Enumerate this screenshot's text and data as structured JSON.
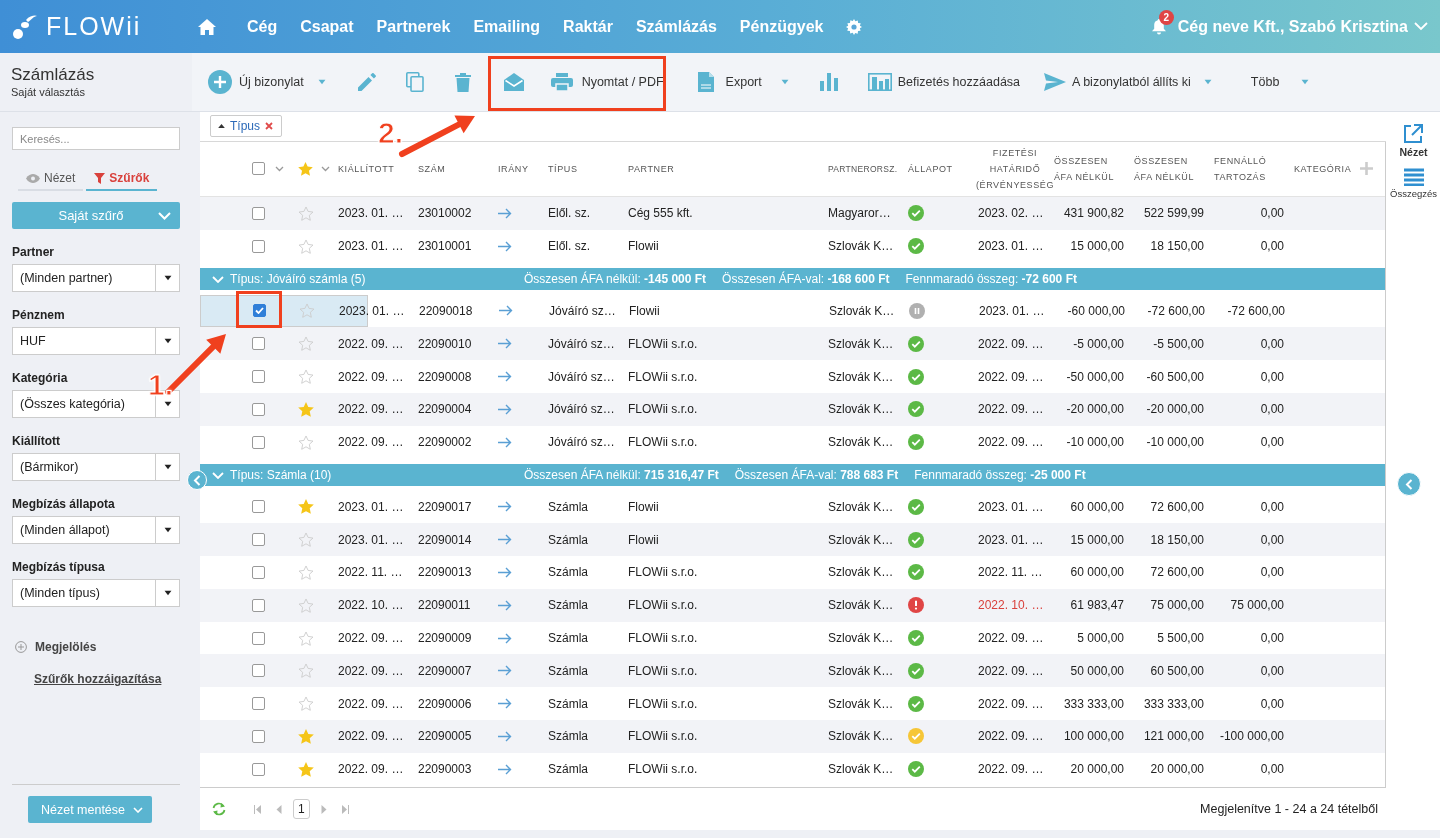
{
  "header": {
    "logo": "FLOWii",
    "nav": [
      {
        "label": "Cég"
      },
      {
        "label": "Csapat"
      },
      {
        "label": "Partnerek"
      },
      {
        "label": "Emailing"
      },
      {
        "label": "Raktár"
      },
      {
        "label": "Számlázás"
      },
      {
        "label": "Pénzügyek"
      }
    ],
    "notifications": "2",
    "user": "Cég neve Kft., Szabó Krisztina"
  },
  "page": {
    "title": "Számlázás",
    "subtitle": "Saját választás"
  },
  "toolbar": [
    {
      "kind": "add",
      "label": "Új bizonylat",
      "dropdown": true
    },
    {
      "kind": "edit"
    },
    {
      "kind": "copy"
    },
    {
      "kind": "delete"
    },
    {
      "kind": "email"
    },
    {
      "kind": "print",
      "label": "Nyomtat / PDF"
    },
    {
      "kind": "export",
      "label": "Export",
      "dropdown": true
    },
    {
      "kind": "stats"
    },
    {
      "kind": "payment",
      "label": "Befizetés hozzáadása"
    },
    {
      "kind": "send",
      "label": "A bizonylatból állíts ki",
      "dropdown": true
    },
    {
      "kind": "more",
      "label": "Több",
      "dropdown": true
    }
  ],
  "sidebar": {
    "search": {
      "placeholder": "Keresés..."
    },
    "tabs": [
      {
        "label": "Nézet",
        "selected": false
      },
      {
        "label": "Szűrők",
        "selected": true
      }
    ],
    "filter_button": "Saját szűrő",
    "filters": [
      {
        "label": "Partner",
        "value": "(Minden partner)"
      },
      {
        "label": "Pénznem",
        "value": "HUF"
      },
      {
        "label": "Kategória",
        "value": "(Összes kategória)"
      },
      {
        "label": "Kiállított",
        "value": "(Bármikor)"
      },
      {
        "label": "Megbízás állapota",
        "value": "(Minden állapot)"
      },
      {
        "label": "Megbízás típusa",
        "value": "(Minden típus)"
      }
    ],
    "mark_link": "Megjelölés",
    "adjust_link": "Szűrők hozzáigazítása",
    "save_button": "Nézet mentése"
  },
  "filter_chips": [
    {
      "label": "Típus"
    }
  ],
  "right_rail": [
    {
      "kind": "view",
      "label": "Nézet"
    },
    {
      "kind": "summary",
      "label": "Összegzés"
    }
  ],
  "table": {
    "all_checked": false,
    "columns": [
      "KIÁLLÍTOTT",
      "SZÁM",
      "IRÁNY",
      "TÍPUS",
      "PARTNER",
      "PARTNERORSZ.",
      "ÁLLAPOT",
      "FIZETÉSI HATÁRIDŐ (ÉRVÉNYESSÉG",
      "ÖSSZESEN ÁFA NÉLKÜL",
      "ÖSSZESEN ÁFA NÉLKÜL",
      "FENNÁLLÓ TARTOZÁS",
      "KATEGÓRIA"
    ],
    "rows": [
      {
        "kind": "row",
        "checked": false,
        "starred": false,
        "issued": "2023. 01. …",
        "number": "23010002",
        "type": "Elől. sz.",
        "partner": "Cég 555 kft.",
        "country": "Magyaror…",
        "status": {
          "kind": "ok"
        },
        "due": "2023. 02. …",
        "overdue": false,
        "net": "431 900,82",
        "gross": "522 599,99",
        "outstanding": "0,00"
      },
      {
        "kind": "row",
        "checked": false,
        "starred": false,
        "issued": "2023. 01. …",
        "number": "23010001",
        "type": "Elől. sz.",
        "partner": "Flowii",
        "country": "Szlovák K…",
        "status": {
          "kind": "ok"
        },
        "due": "2023. 01. …",
        "overdue": false,
        "net": "15 000,00",
        "gross": "18 150,00",
        "outstanding": "0,00"
      },
      {
        "kind": "group",
        "label": "Típus: Jóváíró számla (5)",
        "totals": [
          "Összesen ÁFA nélkül: **-145 000 Ft**",
          "Összesen ÁFA-val: **-168 600 Ft**",
          "Fennmaradó összeg: **-72 600 Ft**"
        ]
      },
      {
        "kind": "row",
        "checked": true,
        "starred": false,
        "issued": "2023. 01. …",
        "number": "22090018",
        "type": "Jóváíró sz…",
        "partner": "Flowii",
        "country": "Szlovák K…",
        "status": {
          "kind": "paused"
        },
        "due": "2023. 01. …",
        "overdue": false,
        "net": "-60 000,00",
        "gross": "-72 600,00",
        "outstanding": "-72 600,00"
      },
      {
        "kind": "row",
        "checked": false,
        "starred": false,
        "issued": "2022. 09. …",
        "number": "22090010",
        "type": "Jóváíró sz…",
        "partner": "FLOWii s.r.o.",
        "country": "Szlovák K…",
        "status": {
          "kind": "ok"
        },
        "due": "2022. 09. …",
        "overdue": false,
        "net": "-5 000,00",
        "gross": "-5 500,00",
        "outstanding": "0,00"
      },
      {
        "kind": "row",
        "checked": false,
        "starred": false,
        "issued": "2022. 09. …",
        "number": "22090008",
        "type": "Jóváíró sz…",
        "partner": "FLOWii s.r.o.",
        "country": "Szlovák K…",
        "status": {
          "kind": "ok"
        },
        "due": "2022. 09. …",
        "overdue": false,
        "net": "-50 000,00",
        "gross": "-60 500,00",
        "outstanding": "0,00"
      },
      {
        "kind": "row",
        "checked": false,
        "starred": true,
        "issued": "2022. 09. …",
        "number": "22090004",
        "type": "Jóváíró sz…",
        "partner": "FLOWii s.r.o.",
        "country": "Szlovák K…",
        "status": {
          "kind": "ok"
        },
        "due": "2022. 09. …",
        "overdue": false,
        "net": "-20 000,00",
        "gross": "-20 000,00",
        "outstanding": "0,00"
      },
      {
        "kind": "row",
        "checked": false,
        "starred": false,
        "issued": "2022. 09. …",
        "number": "22090002",
        "type": "Jóváíró sz…",
        "partner": "FLOWii s.r.o.",
        "country": "Szlovák K…",
        "status": {
          "kind": "ok"
        },
        "due": "2022. 09. …",
        "overdue": false,
        "net": "-10 000,00",
        "gross": "-10 000,00",
        "outstanding": "0,00"
      },
      {
        "kind": "group",
        "label": "Típus: Számla (10)",
        "totals": [
          "Összesen ÁFA nélkül: **715 316,47 Ft**",
          "Összesen ÁFA-val: **788 683 Ft**",
          "Fennmaradó összeg: **-25 000 Ft**"
        ]
      },
      {
        "kind": "row",
        "checked": false,
        "starred": true,
        "issued": "2023. 01. …",
        "number": "22090017",
        "type": "Számla",
        "partner": "Flowii",
        "country": "Szlovák K…",
        "status": {
          "kind": "ok"
        },
        "due": "2023. 01. …",
        "overdue": false,
        "net": "60 000,00",
        "gross": "72 600,00",
        "outstanding": "0,00"
      },
      {
        "kind": "row",
        "checked": false,
        "starred": false,
        "issued": "2023. 01. …",
        "number": "22090014",
        "type": "Számla",
        "partner": "Flowii",
        "country": "Szlovák K…",
        "status": {
          "kind": "ok"
        },
        "due": "2023. 01. …",
        "overdue": false,
        "net": "15 000,00",
        "gross": "18 150,00",
        "outstanding": "0,00"
      },
      {
        "kind": "row",
        "checked": false,
        "starred": false,
        "issued": "2022. 11. …",
        "number": "22090013",
        "type": "Számla",
        "partner": "FLOWii s.r.o.",
        "country": "Szlovák K…",
        "status": {
          "kind": "ok"
        },
        "due": "2022. 11. …",
        "overdue": false,
        "net": "60 000,00",
        "gross": "72 600,00",
        "outstanding": "0,00"
      },
      {
        "kind": "row",
        "checked": false,
        "starred": false,
        "issued": "2022. 10. …",
        "number": "22090011",
        "type": "Számla",
        "partner": "FLOWii s.r.o.",
        "country": "Szlovák K…",
        "status": {
          "kind": "error"
        },
        "due": "2022. 10. …",
        "overdue": true,
        "net": "61 983,47",
        "gross": "75 000,00",
        "outstanding": "75 000,00"
      },
      {
        "kind": "row",
        "checked": false,
        "starred": false,
        "issued": "2022. 09. …",
        "number": "22090009",
        "type": "Számla",
        "partner": "FLOWii s.r.o.",
        "country": "Szlovák K…",
        "status": {
          "kind": "ok"
        },
        "due": "2022. 09. …",
        "overdue": false,
        "net": "5 000,00",
        "gross": "5 500,00",
        "outstanding": "0,00"
      },
      {
        "kind": "row",
        "checked": false,
        "starred": false,
        "issued": "2022. 09. …",
        "number": "22090007",
        "type": "Számla",
        "partner": "FLOWii s.r.o.",
        "country": "Szlovák K…",
        "status": {
          "kind": "ok"
        },
        "due": "2022. 09. …",
        "overdue": false,
        "net": "50 000,00",
        "gross": "60 500,00",
        "outstanding": "0,00"
      },
      {
        "kind": "row",
        "checked": false,
        "starred": false,
        "issued": "2022. 09. …",
        "number": "22090006",
        "type": "Számla",
        "partner": "FLOWii s.r.o.",
        "country": "Szlovák K…",
        "status": {
          "kind": "ok"
        },
        "due": "2022. 09. …",
        "overdue": false,
        "net": "333 333,00",
        "gross": "333 333,00",
        "outstanding": "0,00"
      },
      {
        "kind": "row",
        "checked": false,
        "starred": true,
        "issued": "2022. 09. …",
        "number": "22090005",
        "type": "Számla",
        "partner": "FLOWii s.r.o.",
        "country": "Szlovák K…",
        "status": {
          "kind": "partial"
        },
        "due": "2022. 09. …",
        "overdue": false,
        "net": "100 000,00",
        "gross": "121 000,00",
        "outstanding": "-100 000,00"
      },
      {
        "kind": "row",
        "checked": false,
        "starred": true,
        "issued": "2022. 09. …",
        "number": "22090003",
        "type": "Számla",
        "partner": "FLOWii s.r.o.",
        "country": "Szlovák K…",
        "status": {
          "kind": "ok"
        },
        "due": "2022. 09. …",
        "overdue": false,
        "net": "20 000,00",
        "gross": "20 000,00",
        "outstanding": "0,00"
      }
    ]
  },
  "pager": {
    "page": "1",
    "summary": "Megjelenítve 1 - 24 a 24 tételből"
  },
  "annotations": [
    {
      "label": "1."
    },
    {
      "label": "2."
    }
  ]
}
